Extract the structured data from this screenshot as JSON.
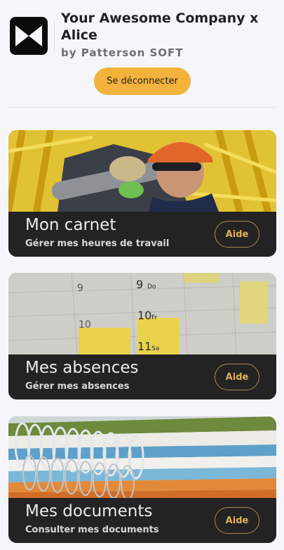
{
  "header": {
    "company_name": "Your Awesome Company x Alice",
    "byline": "by Patterson SOFT",
    "logout_label": "Se déconnecter"
  },
  "cards": [
    {
      "title": "Mon carnet",
      "subtitle": "Gérer mes heures de travail",
      "help_label": "Aide"
    },
    {
      "title": "Mes absences",
      "subtitle": "Gérer mes absences",
      "help_label": "Aide"
    },
    {
      "title": "Mes documents",
      "subtitle": "Consulter mes documents",
      "help_label": "Aide"
    }
  ],
  "calendar_marks": [
    "9",
    "Do",
    "9",
    "10",
    "Fr",
    "10",
    "11",
    "Sa"
  ],
  "colors": {
    "accent": "#f2b23c",
    "bar": "#232323",
    "help_border": "#a9884a"
  }
}
